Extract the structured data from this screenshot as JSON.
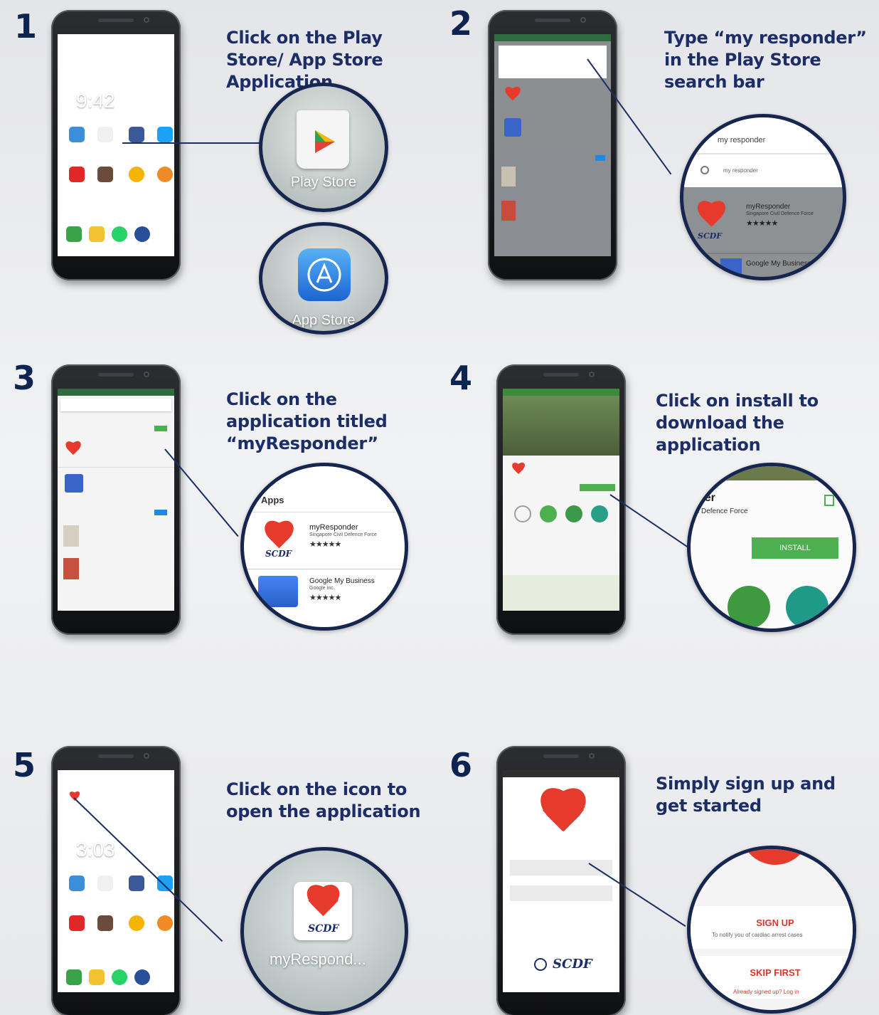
{
  "steps": [
    {
      "number": "1",
      "caption": "Click on the Play Store/ App Store Application"
    },
    {
      "number": "2",
      "caption": "Type “my responder” in the Play Store search bar"
    },
    {
      "number": "3",
      "caption": "Click on the application titled “myResponder”"
    },
    {
      "number": "4",
      "caption": "Click on install to download the application"
    },
    {
      "number": "5",
      "caption": "Click on the icon to open the application"
    },
    {
      "number": "6",
      "caption": "Simply sign up and get started"
    }
  ],
  "step1": {
    "clock": "9:42",
    "play_store_label": "Play Store",
    "app_store_label": "App Store"
  },
  "step2": {
    "search_query": "my responder",
    "suggestion": "my responder",
    "app_name": "myResponder",
    "app_publisher": "Singapore Civil Defence Force",
    "next_app": "Google My Business"
  },
  "step3": {
    "section_label": "Apps",
    "app_name": "myResponder",
    "app_publisher": "Singapore Civil Defence Force",
    "next_app": "Google My Business",
    "next_publisher": "Google Inc."
  },
  "step4": {
    "app_name_fragment": "der",
    "publisher_fragment": "l Defence Force",
    "install_label": "INSTALL"
  },
  "step5": {
    "clock": "3:03",
    "icon_label": "myRespond..."
  },
  "step6": {
    "sign_up_label": "SIGN UP",
    "sign_up_sub": "To notify you of cardiac arrest cases",
    "skip_label": "SKIP FIRST",
    "skip_sub": "Already signed up? Log in",
    "logo": "SCDF"
  },
  "stars": "★★★★★",
  "colors": {
    "accent": "#1d2d66",
    "install_green": "#4caf50",
    "brand_red": "#e53a2c"
  }
}
